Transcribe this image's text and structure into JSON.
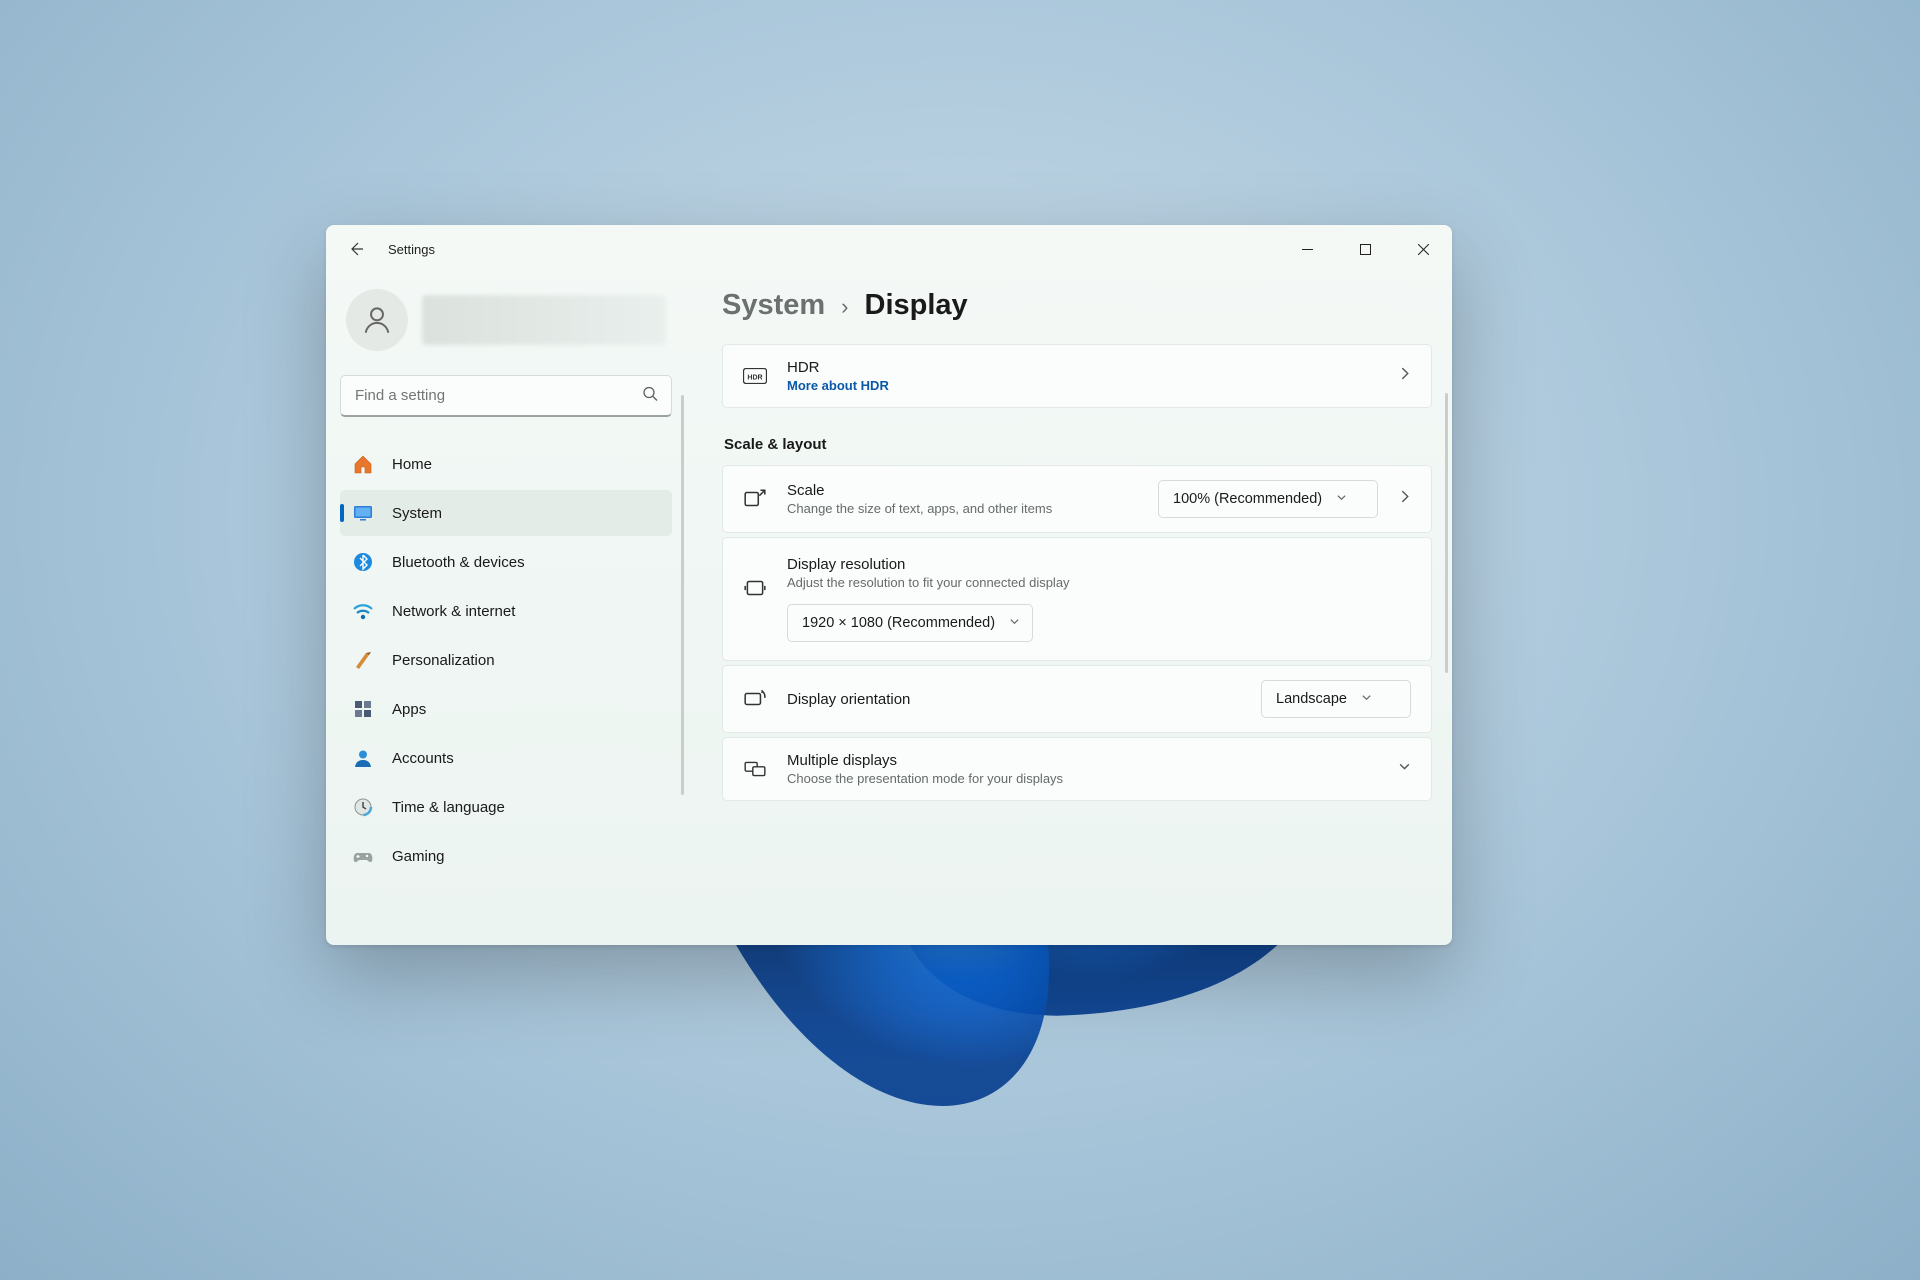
{
  "window": {
    "app_title": "Settings"
  },
  "search": {
    "placeholder": "Find a setting"
  },
  "nav": {
    "items": [
      {
        "label": "Home"
      },
      {
        "label": "System"
      },
      {
        "label": "Bluetooth & devices"
      },
      {
        "label": "Network & internet"
      },
      {
        "label": "Personalization"
      },
      {
        "label": "Apps"
      },
      {
        "label": "Accounts"
      },
      {
        "label": "Time & language"
      },
      {
        "label": "Gaming"
      }
    ]
  },
  "breadcrumb": {
    "parent": "System",
    "current": "Display"
  },
  "hdr": {
    "title": "HDR",
    "link": "More about HDR"
  },
  "section_scale_layout": "Scale & layout",
  "scale": {
    "title": "Scale",
    "sub": "Change the size of text, apps, and other items",
    "value": "100% (Recommended)"
  },
  "resolution": {
    "title": "Display resolution",
    "sub": "Adjust the resolution to fit your connected display",
    "value": "1920 × 1080 (Recommended)"
  },
  "orientation": {
    "title": "Display orientation",
    "value": "Landscape"
  },
  "multiple": {
    "title": "Multiple displays",
    "sub": "Choose the presentation mode for your displays"
  }
}
